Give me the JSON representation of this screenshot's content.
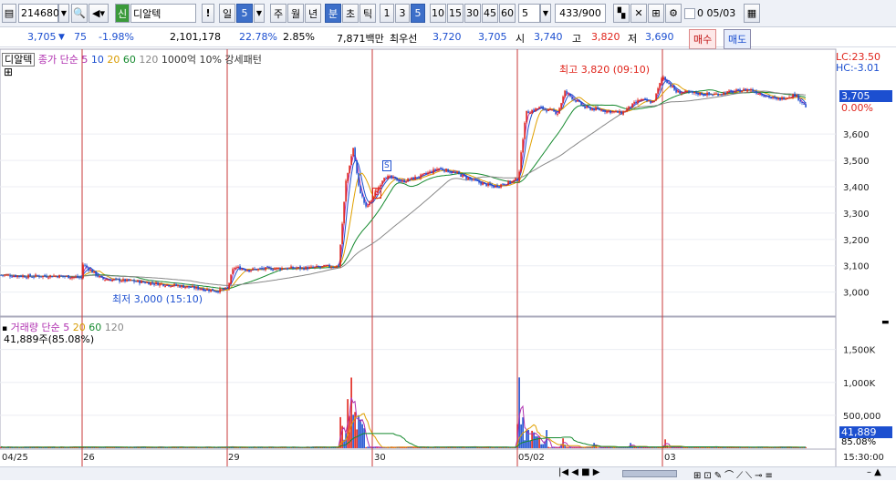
{
  "toolbar": {
    "code": "214680",
    "badge": "신",
    "name": "디알텍",
    "excl": "!",
    "period_label": "일",
    "period_value": "5",
    "tabs": [
      "주",
      "월",
      "년",
      "분",
      "초",
      "틱"
    ],
    "selected_tab": "분",
    "intervals": [
      "1",
      "3",
      "5",
      "10",
      "15",
      "30",
      "45",
      "60"
    ],
    "selected_interval": "5",
    "count_input": "5",
    "page_count": "433/900",
    "check_label": "0",
    "date": "05/03"
  },
  "quote": {
    "price": "3,705",
    "change": "75",
    "change_pct": "-1.98%",
    "volume": "2,101,178",
    "turnover_pct": "22.78%",
    "ratio": "2.85%",
    "amount": "7,871백만",
    "best_label": "최우선",
    "best_ask": "3,720",
    "best_bid": "3,705",
    "open_label": "시",
    "open": "3,740",
    "high_label": "고",
    "high": "3,820",
    "low_label": "저",
    "low": "3,690",
    "buy_button": "매수",
    "sell_button": "매도"
  },
  "price_panel": {
    "name": "디알텍",
    "close_label": "종가",
    "ma_label": "단순",
    "ma_periods": [
      "5",
      "10",
      "20",
      "60",
      "120"
    ],
    "extra": "1000억 10% 강세패턴",
    "lc": "LC:23.50",
    "hc": "HC:-3.01",
    "current_price_tag": "3,705",
    "current_pct_tag": "0.00%",
    "high_annotation": "최고 3,820 (09:10)",
    "low_annotation": "최저 3,000 (15:10)",
    "signal_s": "S",
    "signal_b": "B"
  },
  "volume_panel": {
    "label": "거래량",
    "ma_label": "단순",
    "ma_periods": [
      "5",
      "20",
      "60",
      "120"
    ],
    "value_text": "41,889주(85.08%)",
    "current_tag": "41,889",
    "pct_tag": "85.08%"
  },
  "time_axis": {
    "labels": [
      "04/25",
      "26",
      "29",
      "30",
      "05/02",
      "03"
    ],
    "end_time": "15:30:00"
  },
  "chart_data": {
    "type": "candlestick",
    "price_axis": {
      "ticks": [
        3000,
        3100,
        3200,
        3300,
        3400,
        3500,
        3600
      ],
      "range": [
        2940,
        3860
      ]
    },
    "volume_axis": {
      "ticks": [
        "500,000",
        "1,000K",
        "1,500K"
      ],
      "range": [
        0,
        1800000
      ]
    },
    "price_path": [
      {
        "t": 0,
        "p": 3065
      },
      {
        "t": 30,
        "p": 3060
      },
      {
        "t": 60,
        "p": 3062
      },
      {
        "t": 88,
        "p": 3055
      },
      {
        "t": 90,
        "p": 3105
      },
      {
        "t": 110,
        "p": 3050
      },
      {
        "t": 150,
        "p": 3040
      },
      {
        "t": 200,
        "p": 3022
      },
      {
        "t": 236,
        "p": 3005
      },
      {
        "t": 248,
        "p": 3012
      },
      {
        "t": 255,
        "p": 3095
      },
      {
        "t": 270,
        "p": 3085
      },
      {
        "t": 300,
        "p": 3090
      },
      {
        "t": 340,
        "p": 3092
      },
      {
        "t": 370,
        "p": 3100
      },
      {
        "t": 378,
        "p": 3420
      },
      {
        "t": 386,
        "p": 3548
      },
      {
        "t": 392,
        "p": 3400
      },
      {
        "t": 400,
        "p": 3320
      },
      {
        "t": 408,
        "p": 3360
      },
      {
        "t": 420,
        "p": 3440
      },
      {
        "t": 440,
        "p": 3420
      },
      {
        "t": 460,
        "p": 3440
      },
      {
        "t": 480,
        "p": 3470
      },
      {
        "t": 500,
        "p": 3450
      },
      {
        "t": 520,
        "p": 3420
      },
      {
        "t": 540,
        "p": 3400
      },
      {
        "t": 560,
        "p": 3420
      },
      {
        "t": 567,
        "p": 3430
      },
      {
        "t": 575,
        "p": 3680
      },
      {
        "t": 590,
        "p": 3700
      },
      {
        "t": 610,
        "p": 3680
      },
      {
        "t": 618,
        "p": 3760
      },
      {
        "t": 640,
        "p": 3700
      },
      {
        "t": 660,
        "p": 3690
      },
      {
        "t": 680,
        "p": 3680
      },
      {
        "t": 700,
        "p": 3730
      },
      {
        "t": 715,
        "p": 3720
      },
      {
        "t": 725,
        "p": 3820
      },
      {
        "t": 740,
        "p": 3760
      },
      {
        "t": 780,
        "p": 3750
      },
      {
        "t": 820,
        "p": 3770
      },
      {
        "t": 850,
        "p": 3730
      },
      {
        "t": 870,
        "p": 3750
      },
      {
        "t": 882,
        "p": 3705
      }
    ],
    "volume_spikes": [
      {
        "t": 373,
        "v": 800000
      },
      {
        "t": 380,
        "v": 1000000
      },
      {
        "t": 384,
        "v": 1650000
      },
      {
        "t": 388,
        "v": 850000
      },
      {
        "t": 392,
        "v": 600000
      },
      {
        "t": 396,
        "v": 400000
      },
      {
        "t": 568,
        "v": 1100000
      },
      {
        "t": 572,
        "v": 550000
      },
      {
        "t": 577,
        "v": 480000
      },
      {
        "t": 583,
        "v": 400000
      },
      {
        "t": 590,
        "v": 250000
      },
      {
        "t": 616,
        "v": 200000
      },
      {
        "t": 650,
        "v": 130000
      },
      {
        "t": 690,
        "v": 120000
      },
      {
        "t": 728,
        "v": 150000
      }
    ]
  },
  "colors": {
    "up": "#e0251c",
    "down": "#1c4fd0",
    "ma5": "#b030b0",
    "ma10": "#1c4fd0",
    "ma20": "#e0a000",
    "ma60": "#168a2f",
    "ma120": "#888888"
  }
}
